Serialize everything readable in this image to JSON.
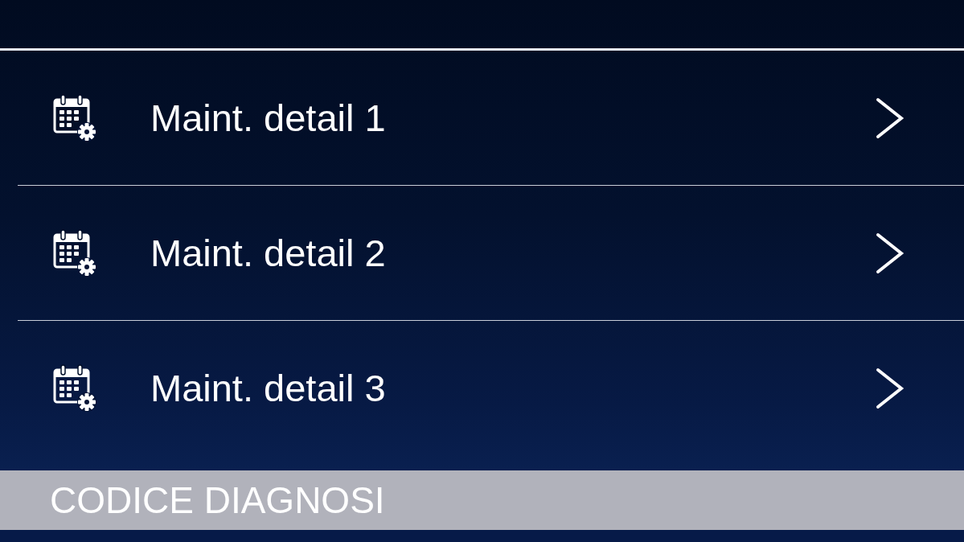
{
  "rows": [
    {
      "label": "Maint. detail 1"
    },
    {
      "label": "Maint. detail 2"
    },
    {
      "label": "Maint. detail 3"
    }
  ],
  "section_header": {
    "title": "CODICE DIAGNOSI"
  }
}
